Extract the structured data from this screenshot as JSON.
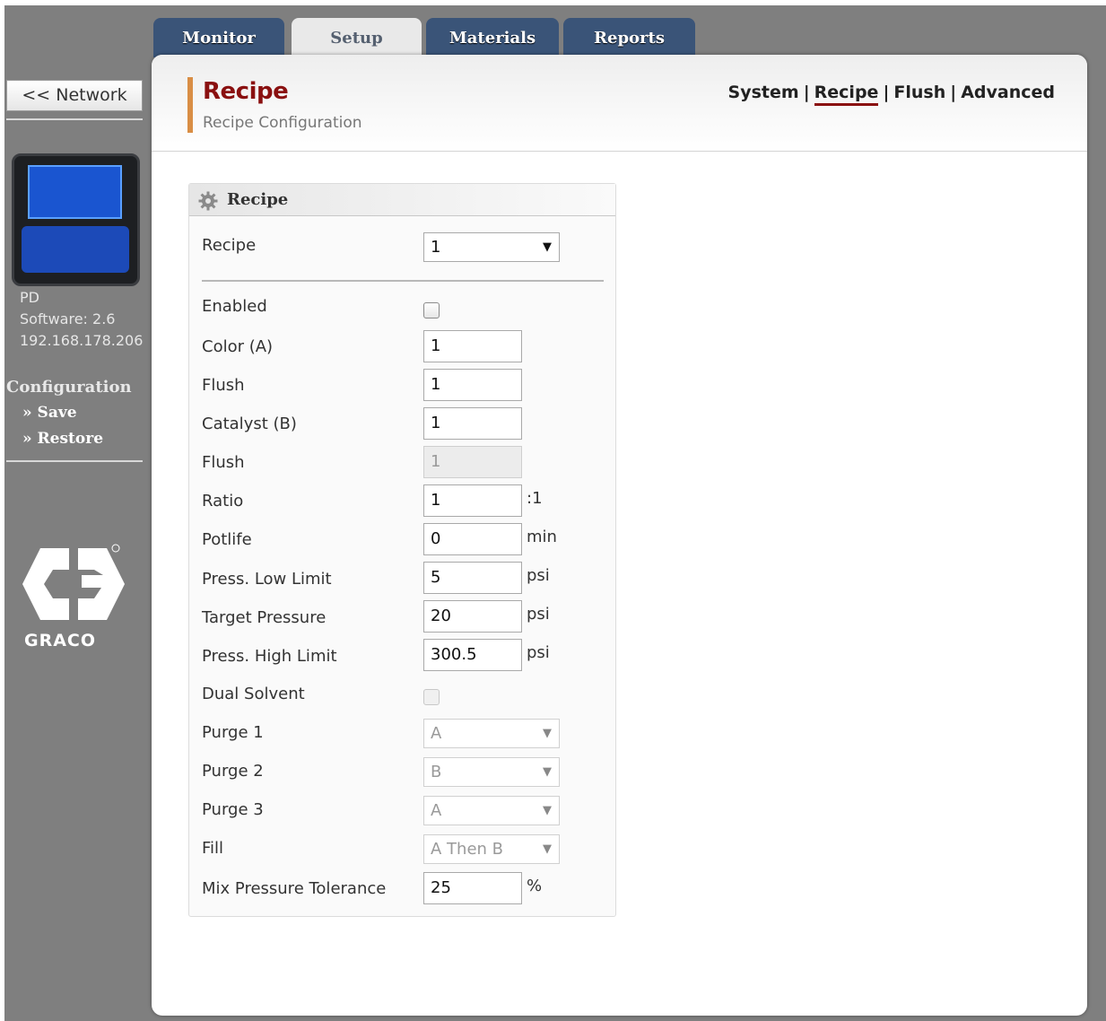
{
  "tabs": [
    {
      "label": "Monitor"
    },
    {
      "label": "Setup"
    },
    {
      "label": "Materials"
    },
    {
      "label": "Reports"
    }
  ],
  "sidebar": {
    "network_button": "<< Network",
    "device_name": "PD",
    "software": "Software: 2.6",
    "ip": "192.168.178.206",
    "config_title": "Configuration",
    "save": "» Save",
    "restore": "» Restore",
    "logo_text": "GRACO"
  },
  "header": {
    "title": "Recipe",
    "subtitle": "Recipe Configuration",
    "nav": [
      "System",
      "Recipe",
      "Flush",
      "Advanced"
    ],
    "nav_sep": "|"
  },
  "panel": {
    "title": "Recipe",
    "fields": {
      "recipe": {
        "label": "Recipe",
        "value": "1"
      },
      "enabled": {
        "label": "Enabled",
        "checked": false
      },
      "color_a": {
        "label": "Color (A)",
        "value": "1"
      },
      "flush1": {
        "label": "Flush",
        "value": "1"
      },
      "catalyst_b": {
        "label": "Catalyst (B)",
        "value": "1"
      },
      "flush2": {
        "label": "Flush",
        "value": "1"
      },
      "ratio": {
        "label": "Ratio",
        "value": "1",
        "unit": ":1"
      },
      "potlife": {
        "label": "Potlife",
        "value": "0",
        "unit": "min"
      },
      "press_low": {
        "label": "Press. Low Limit",
        "value": "5",
        "unit": "psi"
      },
      "target_pressure": {
        "label": "Target Pressure",
        "value": "20",
        "unit": "psi"
      },
      "press_high": {
        "label": "Press. High Limit",
        "value": "300.5",
        "unit": "psi"
      },
      "dual_solvent": {
        "label": "Dual Solvent",
        "checked": false
      },
      "purge1": {
        "label": "Purge 1",
        "value": "A"
      },
      "purge2": {
        "label": "Purge 2",
        "value": "B"
      },
      "purge3": {
        "label": "Purge 3",
        "value": "A"
      },
      "fill": {
        "label": "Fill",
        "value": "A Then B"
      },
      "mix_tol": {
        "label": "Mix Pressure Tolerance",
        "value": "25",
        "unit": "%"
      }
    },
    "arrow": "▼"
  },
  "colors": {
    "tab_bg": "#3a5478",
    "title_red": "#8a1010",
    "accent_orange": "#d98e45",
    "sidebar_gray": "#7f7f7f"
  },
  "icons": {
    "gear": "gear-icon",
    "dropdown": "chevron-down-icon",
    "logo": "graco-logo"
  }
}
